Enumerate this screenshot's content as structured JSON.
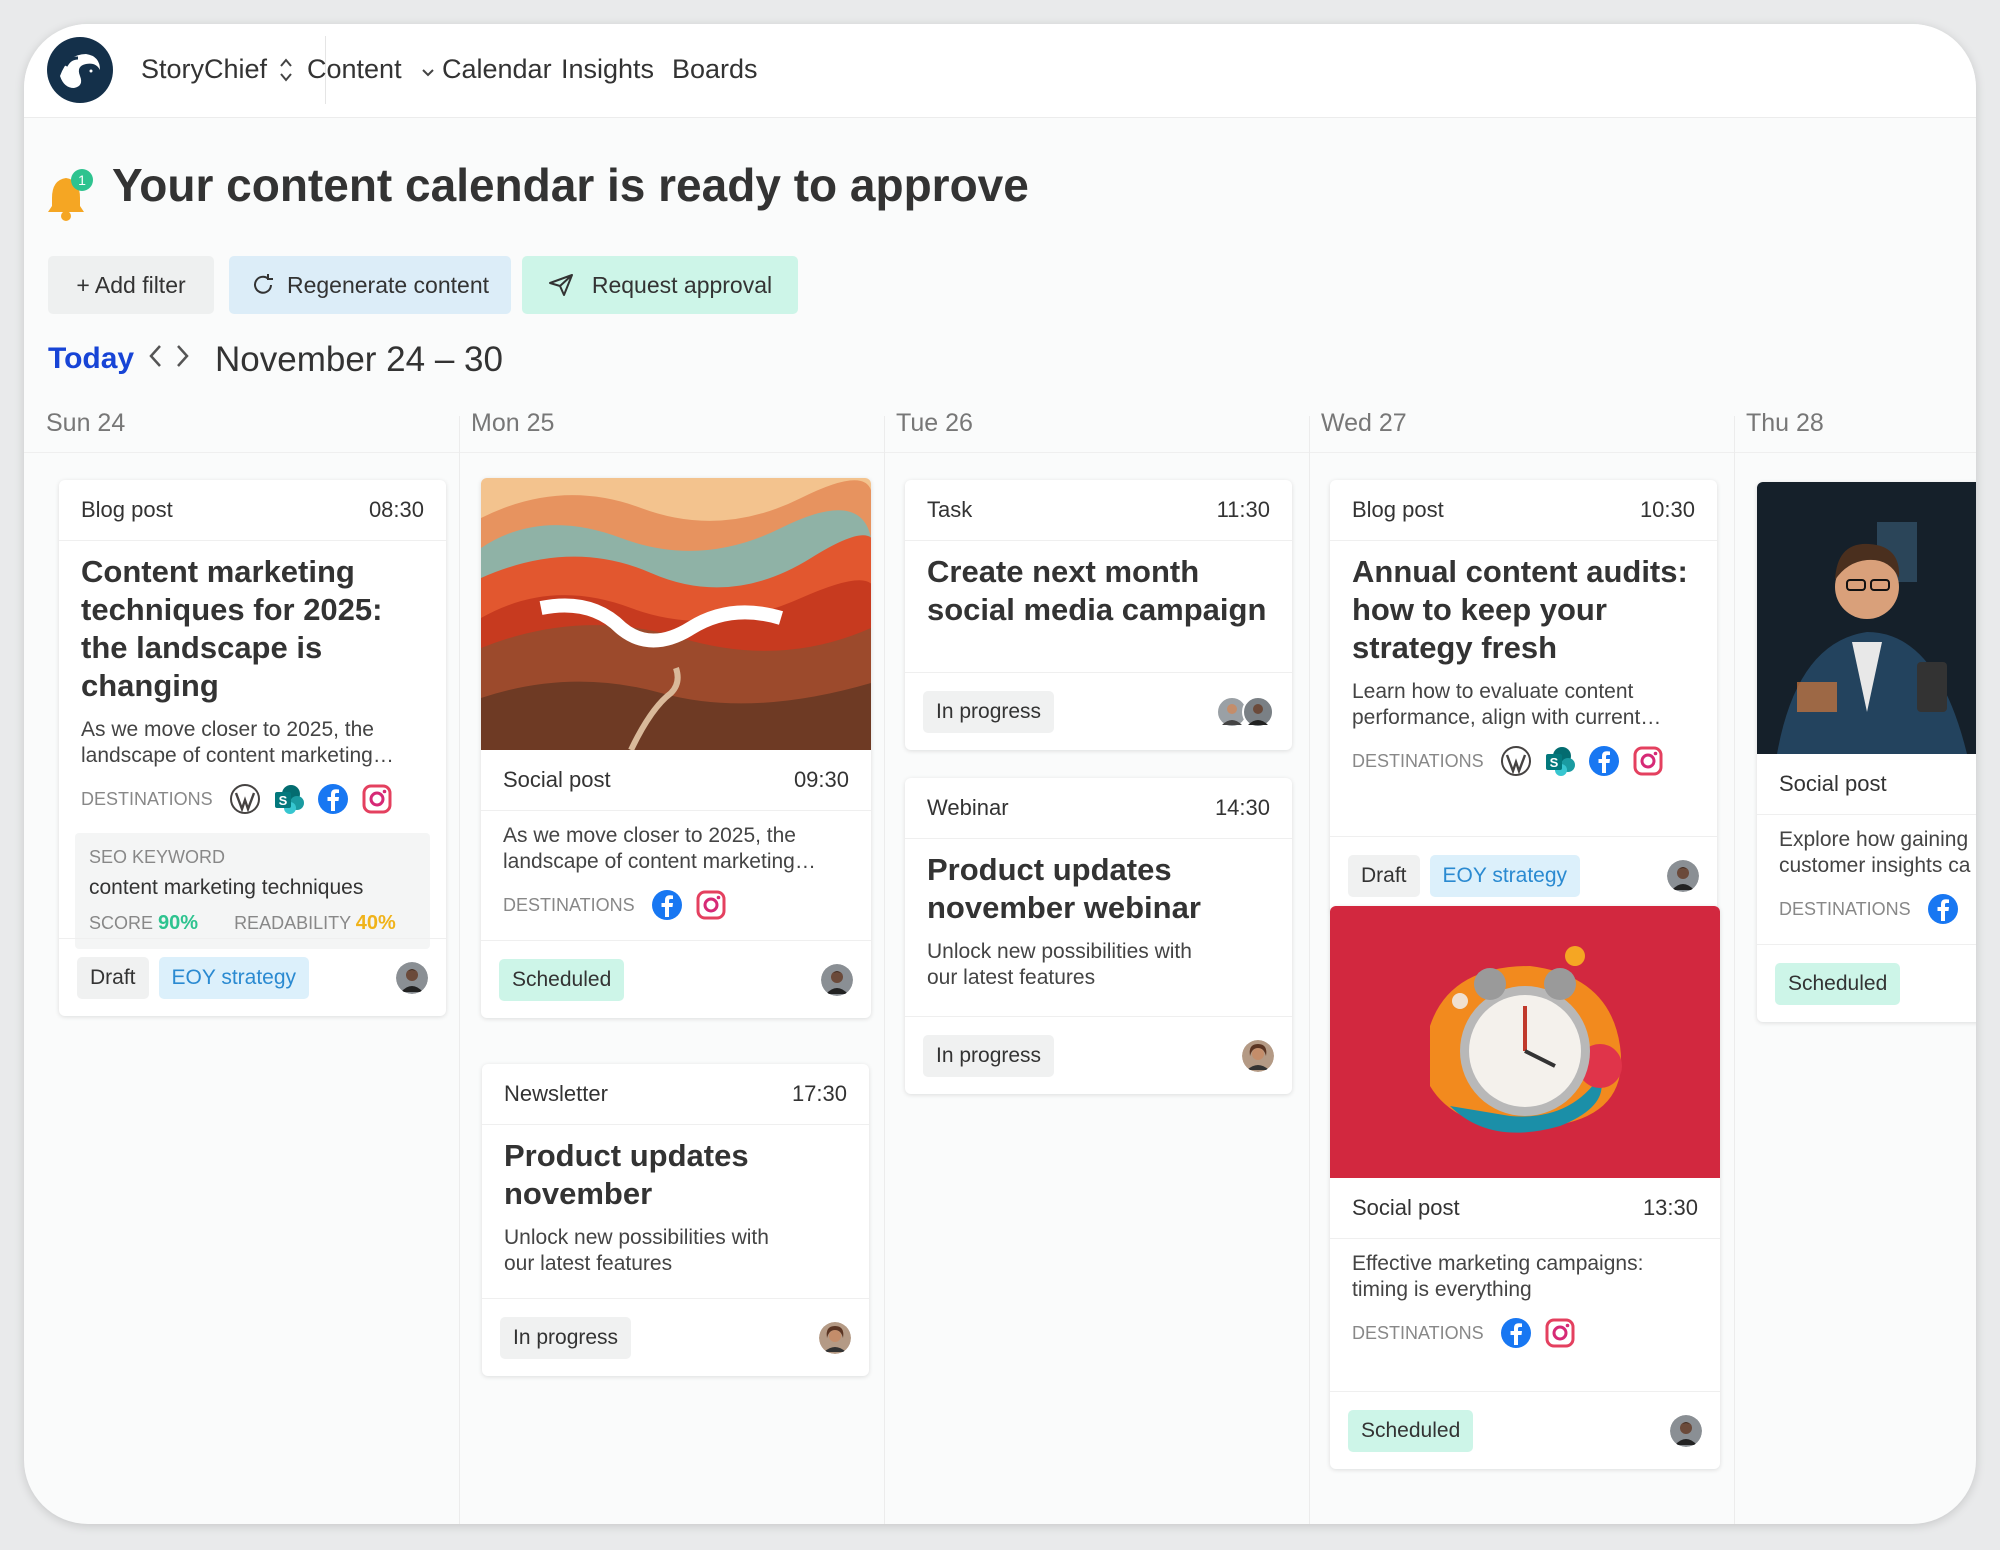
{
  "nav": {
    "brand": "StoryChief",
    "items": [
      "Content",
      "Calendar",
      "Insights",
      "Boards"
    ]
  },
  "notification": {
    "badge": "1"
  },
  "page_title": "Your content calendar is ready to approve",
  "actions": {
    "add_filter": "+ Add filter",
    "regenerate": "Regenerate content",
    "request_approval": "Request approval"
  },
  "date_nav": {
    "today": "Today",
    "range": "November 24 – 30"
  },
  "days": [
    "Sun 24",
    "Mon 25",
    "Tue 26",
    "Wed 27",
    "Thu 28"
  ],
  "labels": {
    "destinations": "DESTINATIONS",
    "seo_keyword": "SEO KEYWORD",
    "score": "SCORE",
    "readability": "READABILITY"
  },
  "cards": {
    "sun_blog": {
      "type": "Blog post",
      "time": "08:30",
      "title": "Content marketing techniques for 2025: the landscape is changing",
      "desc": "As we move closer to 2025, the\nlandscape of content marketing…",
      "seo_keyword": "content marketing techniques",
      "score": "90%",
      "readability": "40%",
      "status": "Draft",
      "tag": "EOY strategy"
    },
    "mon_social": {
      "type": "Social post",
      "time": "09:30",
      "desc": "As we move closer to 2025, the\nlandscape of content marketing…",
      "status": "Scheduled"
    },
    "mon_newsletter": {
      "type": "Newsletter",
      "time": "17:30",
      "title": "Product updates november",
      "desc": "Unlock new possibilities with\nour latest features",
      "status": "In progress"
    },
    "tue_task": {
      "type": "Task",
      "time": "11:30",
      "title": "Create next month social media campaign",
      "status": "In progress"
    },
    "tue_webinar": {
      "type": "Webinar",
      "time": "14:30",
      "title": "Product updates november webinar",
      "desc": "Unlock new possibilities with\nour latest features",
      "status": "In progress"
    },
    "wed_blog": {
      "type": "Blog post",
      "time": "10:30",
      "title": "Annual content audits: how to keep your strategy fresh",
      "desc": "Learn how to evaluate content\nperformance, align with current…",
      "status": "Draft",
      "tag": "EOY strategy"
    },
    "wed_social": {
      "type": "Social post",
      "time": "13:30",
      "desc": "Effective marketing campaigns:\ntiming is everything",
      "status": "Scheduled"
    },
    "thu_social": {
      "type": "Social post",
      "desc": "Explore how gaining\ncustomer insights ca",
      "status": "Scheduled"
    }
  },
  "colors": {
    "accent_blue": "#1744d6",
    "scheduled_bg": "#cdf5e8",
    "tag_bg": "#dcf0fb",
    "score_green": "#2ec38f",
    "readability_yellow": "#f0b31a",
    "bell_orange": "#f5a623"
  }
}
